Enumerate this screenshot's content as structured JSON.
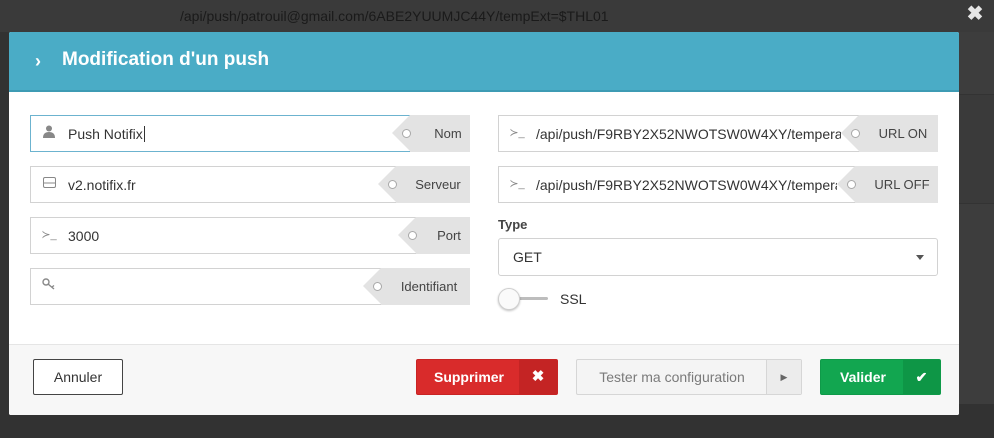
{
  "background": {
    "url_text": "/api/push/patrouil@gmail.com/6ABE2YUUMJC44Y/tempExt=$THL01",
    "close_glyph": "✖"
  },
  "modal": {
    "title": "Modification d'un push",
    "header_icon": "chevron-right-icon",
    "header_color": "#4aacc6"
  },
  "fields_left": [
    {
      "icon": "user-icon",
      "glyph": "👤",
      "value": "Push Notifix",
      "tag": "Nom",
      "focused": true
    },
    {
      "icon": "server-icon",
      "glyph": "⊟",
      "value": "v2.notifix.fr",
      "tag": "Serveur"
    },
    {
      "icon": "terminal-icon",
      "glyph": "≻_",
      "value": "3000",
      "tag": "Port"
    },
    {
      "icon": "key-icon",
      "glyph": "⚷",
      "value": "",
      "tag": "Identifiant"
    }
  ],
  "fields_right": [
    {
      "icon": "terminal-icon",
      "glyph": "≻_",
      "value": "/api/push/F9RBY2X52NWOTSW0W4XY/tempera",
      "tag": "URL ON"
    },
    {
      "icon": "terminal-icon",
      "glyph": "≻_",
      "value": "/api/push/F9RBY2X52NWOTSW0W4XY/tempera",
      "tag": "URL OFF"
    }
  ],
  "type": {
    "label": "Type",
    "selected": "GET"
  },
  "ssl": {
    "label": "SSL",
    "enabled": false
  },
  "footer": {
    "cancel_label": "Annuler",
    "delete_label": "Supprimer",
    "delete_glyph": "✖",
    "test_label": "Tester ma configuration",
    "test_glyph": "▶",
    "validate_label": "Valider",
    "validate_glyph": "✔",
    "colors": {
      "delete": "#d92b2b",
      "validate": "#12a650"
    }
  }
}
